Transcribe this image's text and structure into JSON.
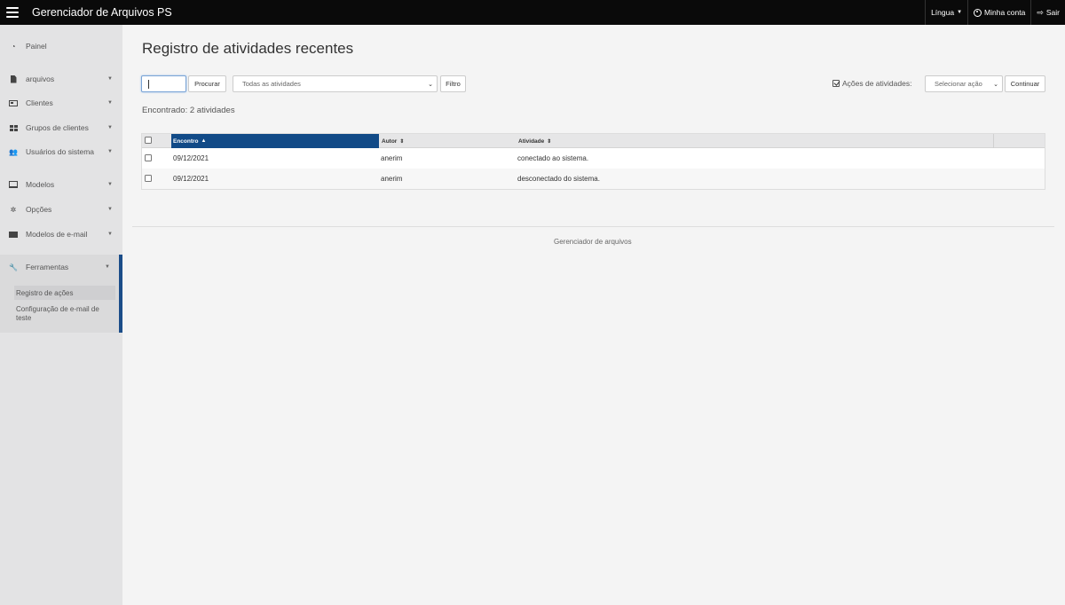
{
  "header": {
    "app_title": "Gerenciador de Arquivos PS",
    "language_label": "Língua",
    "account_label": "Minha conta",
    "logout_label": "Sair"
  },
  "sidebar": {
    "items": [
      {
        "label": "Painel",
        "icon": "dashboard-icon"
      },
      {
        "label": "arquivos",
        "icon": "file-icon"
      },
      {
        "label": "Clientes",
        "icon": "id-card-icon"
      },
      {
        "label": "Grupos de clientes",
        "icon": "grid-icon"
      },
      {
        "label": "Usuários do sistema",
        "icon": "users-icon"
      },
      {
        "label": "Modelos",
        "icon": "monitor-icon"
      },
      {
        "label": "Opções",
        "icon": "gear-icon"
      },
      {
        "label": "Modelos de e-mail",
        "icon": "envelope-icon"
      },
      {
        "label": "Ferramentas",
        "icon": "wrench-icon"
      }
    ],
    "tools_subitems": [
      {
        "label": "Registro de ações",
        "active": true
      },
      {
        "label": "Configuração de e-mail de teste",
        "active": false
      }
    ]
  },
  "main": {
    "title": "Registro de atividades recentes",
    "search": {
      "value": "",
      "button_label": "Procurar"
    },
    "filter": {
      "selected": "Todas as atividades",
      "button_label": "Filtro"
    },
    "actions": {
      "label": "Ações de atividades:",
      "select_placeholder": "Selecionar ação",
      "button_label": "Continuar"
    },
    "found_text": "Encontrado: 2 atividades",
    "table": {
      "columns": [
        "Encontro",
        "Autor",
        "Atividade"
      ],
      "sorted_column": "Encontro",
      "rows": [
        {
          "date": "09/12/2021",
          "author": "anerim",
          "activity": "conectado ao sistema."
        },
        {
          "date": "09/12/2021",
          "author": "anerim",
          "activity": "desconectado do sistema."
        }
      ]
    }
  },
  "footer": {
    "text": "Gerenciador de arquivos"
  },
  "colors": {
    "topbar": "#0a0a0a",
    "sidebar": "#e3e3e4",
    "accent": "#114a87",
    "background": "#f4f4f4"
  }
}
